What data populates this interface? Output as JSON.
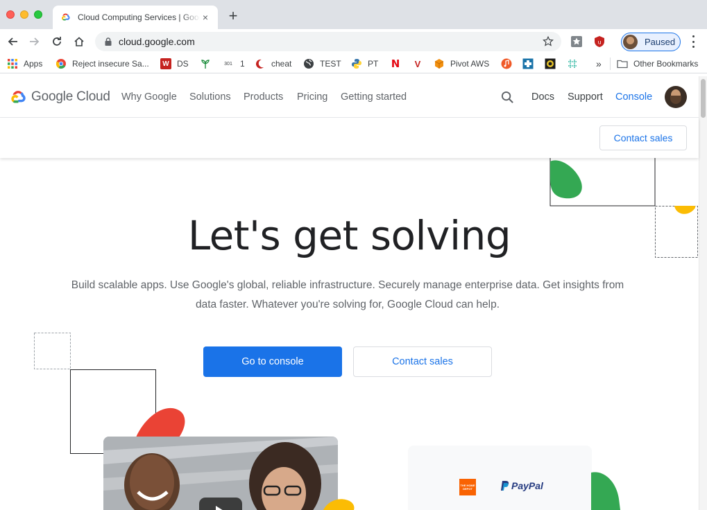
{
  "browser": {
    "tab_title": "Cloud Computing Services  |  Google Cloud",
    "tab_close": "×",
    "new_tab": "+",
    "url": "cloud.google.com",
    "profile_status": "Paused"
  },
  "bookmarks": {
    "items": [
      {
        "label": "Apps",
        "icon": "apps-grid-icon"
      },
      {
        "label": "Reject insecure Sa...",
        "icon": "chrome-icon"
      },
      {
        "label": "DS",
        "icon": "w-icon"
      },
      {
        "label": "",
        "icon": "plant-icon"
      },
      {
        "label": "1",
        "icon": "301-icon",
        "icon_text": "301"
      },
      {
        "label": "cheat",
        "icon": "crescent-icon"
      },
      {
        "label": "TEST",
        "icon": "globe-icon"
      },
      {
        "label": "PT",
        "icon": "python-icon"
      },
      {
        "label": "",
        "icon": "netflix-icon",
        "icon_text": "N"
      },
      {
        "label": "",
        "icon": "v-icon",
        "icon_text": "V"
      },
      {
        "label": "Pivot AWS",
        "icon": "aws-box-icon"
      }
    ],
    "overflow": "»",
    "other_bookmarks": "Other Bookmarks"
  },
  "header": {
    "logo_text": "Google Cloud",
    "nav": [
      "Why Google",
      "Solutions",
      "Products",
      "Pricing",
      "Getting started"
    ],
    "right": {
      "docs": "Docs",
      "support": "Support",
      "console": "Console"
    }
  },
  "subbar": {
    "contact_sales": "Contact sales"
  },
  "hero": {
    "title": "Let's get solving",
    "subtitle": "Build scalable apps. Use Google's global, reliable infrastructure. Securely manage enterprise data. Get insights from data faster. Whatever you're solving for, Google Cloud can help.",
    "primary_button": "Go to console",
    "secondary_button": "Contact sales"
  },
  "partners": {
    "paypal": "PayPal",
    "home_depot": "THE HOME DEPOT"
  },
  "colors": {
    "accent": "#1a73e8",
    "google_green": "#34a853",
    "google_yellow": "#fbbc04",
    "google_red": "#ea4335",
    "google_blue": "#4285f4"
  }
}
